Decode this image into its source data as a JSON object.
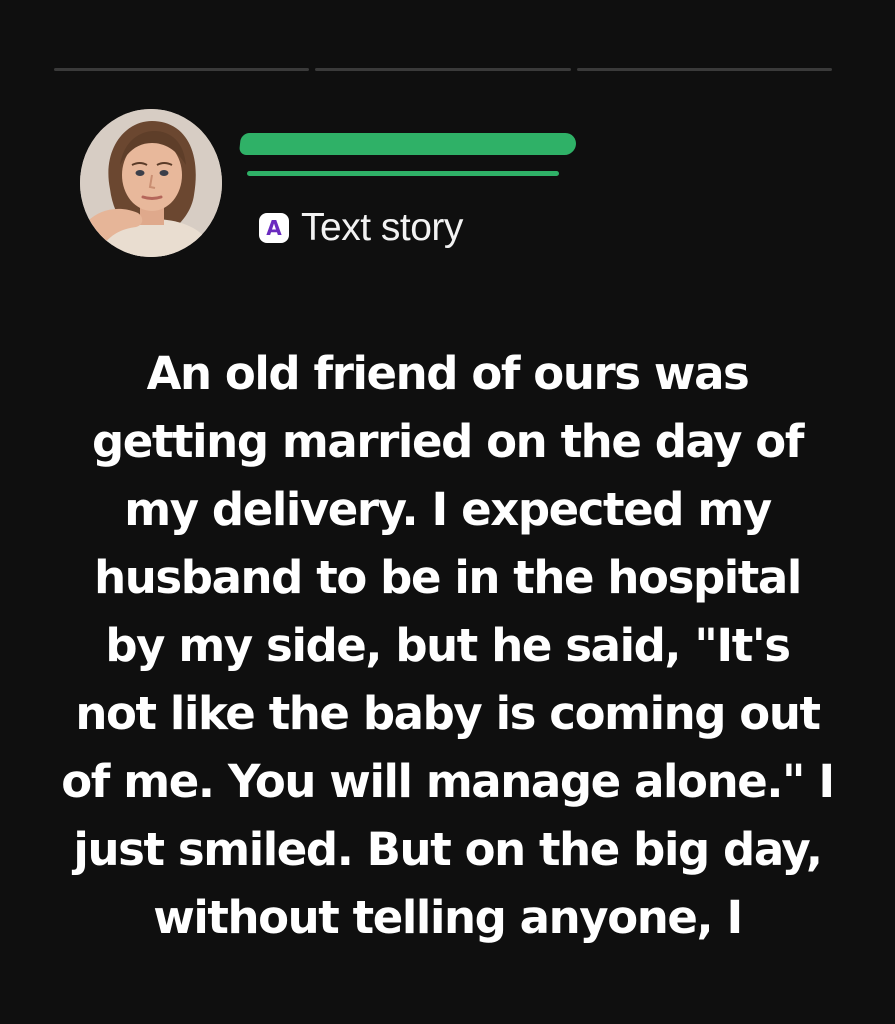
{
  "progress": {
    "segments": 3
  },
  "author": {
    "avatar_icon": "woman-portrait-avatar",
    "name_redacted": true,
    "redaction_color": "#2fb167"
  },
  "story": {
    "badge_letter": "A",
    "badge_color": "#6a2bbf",
    "type_label": "Text story",
    "text": "An old friend of ours was getting married on the day of my delivery. I expected my husband to be in the hospital by my side, but he said, \"It's not like the baby is coming out of me. You will manage alone.\" I just smiled. But on the big day, without telling anyone, I"
  },
  "colors": {
    "background": "#0f0f0f",
    "text": "#ffffff"
  }
}
